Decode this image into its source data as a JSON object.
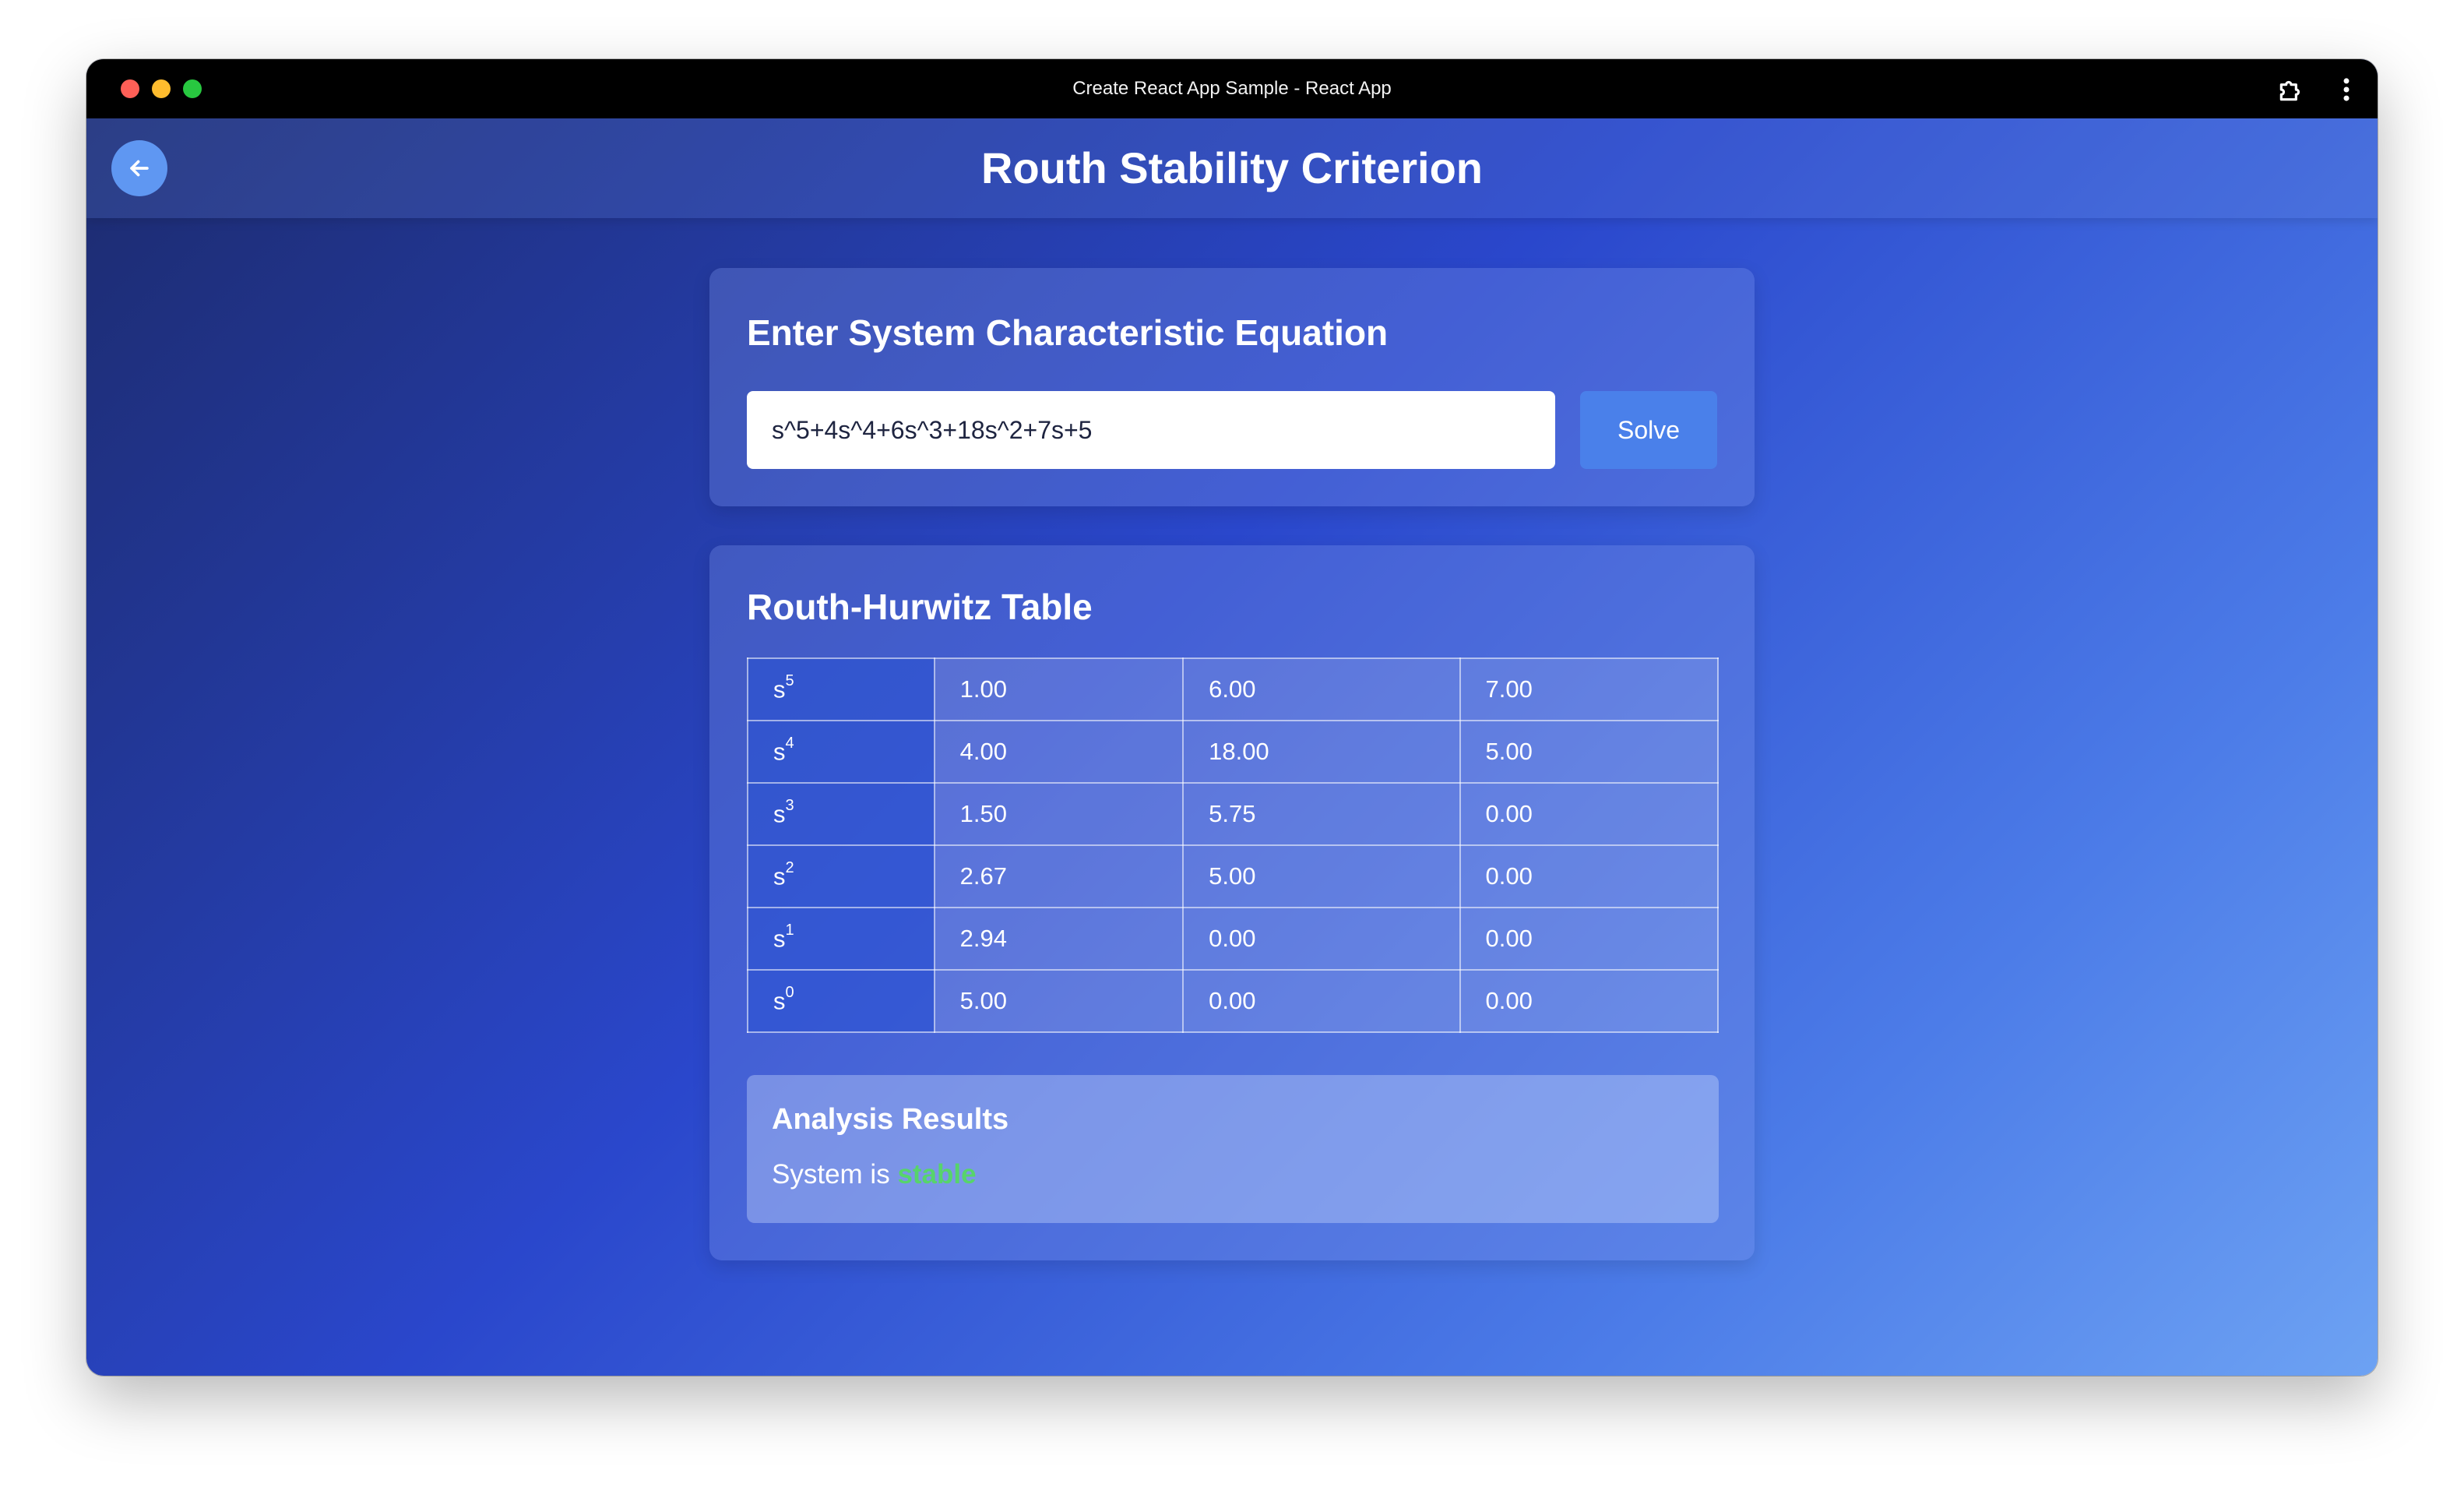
{
  "window": {
    "title": "Create React App Sample - React App",
    "traffic_lights": {
      "close": "#fe5f57",
      "minimize": "#febc2e",
      "zoom": "#28c840"
    },
    "icons": {
      "extension": "puzzle-piece-icon",
      "menu": "more-vertical-icon"
    }
  },
  "header": {
    "title": "Routh Stability Criterion",
    "back_icon": "arrow-left-icon",
    "back_button_color": "#5f97f2"
  },
  "equation_card": {
    "heading": "Enter System Characteristic Equation",
    "input_value": "s^5+4s^4+6s^3+18s^2+7s+5",
    "solve_label": "Solve",
    "solve_color": "#4a80ea"
  },
  "table_card": {
    "heading": "Routh-Hurwitz Table",
    "rows": [
      {
        "base": "s",
        "power": "5",
        "values": [
          "1.00",
          "6.00",
          "7.00"
        ]
      },
      {
        "base": "s",
        "power": "4",
        "values": [
          "4.00",
          "18.00",
          "5.00"
        ]
      },
      {
        "base": "s",
        "power": "3",
        "values": [
          "1.50",
          "5.75",
          "0.00"
        ]
      },
      {
        "base": "s",
        "power": "2",
        "values": [
          "2.67",
          "5.00",
          "0.00"
        ]
      },
      {
        "base": "s",
        "power": "1",
        "values": [
          "2.94",
          "0.00",
          "0.00"
        ]
      },
      {
        "base": "s",
        "power": "0",
        "values": [
          "5.00",
          "0.00",
          "0.00"
        ]
      }
    ]
  },
  "results": {
    "heading": "Analysis Results",
    "prefix": "System is",
    "status": "stable",
    "status_color": "#57d46b"
  },
  "theme": {
    "gradient": [
      "#1c2a6b",
      "#2a47cc",
      "#4c7ce8",
      "#6da2f3"
    ]
  }
}
